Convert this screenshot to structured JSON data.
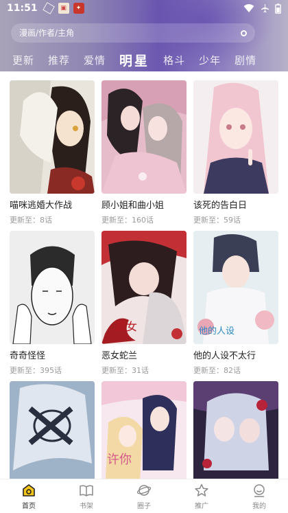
{
  "status": {
    "time": "11:51",
    "icons": [
      "cube-icon",
      "photo-icon",
      "app-icon",
      "wifi-icon",
      "airplane-icon",
      "battery-icon"
    ]
  },
  "search": {
    "placeholder": "漫画/作者/主角"
  },
  "tabs": [
    {
      "label": "更新"
    },
    {
      "label": "推荐"
    },
    {
      "label": "爱情"
    },
    {
      "label": "明星",
      "active": true
    },
    {
      "label": "格斗"
    },
    {
      "label": "少年"
    },
    {
      "label": "剧情"
    }
  ],
  "comics": [
    {
      "title": "喵咪逃婚大作战",
      "update": "更新至：8话"
    },
    {
      "title": "顾小姐和曲小姐",
      "update": "更新至：160话"
    },
    {
      "title": "该死的告白日",
      "update": "更新至：59话"
    },
    {
      "title": "奇奇怪怪",
      "update": "更新至：395话"
    },
    {
      "title": "恶女蛇兰",
      "update": "更新至：31话"
    },
    {
      "title": "他的人设不太行",
      "update": "更新至：82话"
    },
    {
      "title": "",
      "update": ""
    },
    {
      "title": "",
      "update": ""
    },
    {
      "title": "",
      "update": ""
    }
  ],
  "nav": [
    {
      "label": "首页",
      "icon": "home-icon",
      "active": true
    },
    {
      "label": "书架",
      "icon": "bookshelf-icon"
    },
    {
      "label": "圈子",
      "icon": "planet-icon"
    },
    {
      "label": "推广",
      "icon": "star-icon"
    },
    {
      "label": "我的",
      "icon": "profile-icon"
    }
  ],
  "colors": {
    "header_accent": "#6c58b0",
    "nav_active": "#f3c51a"
  }
}
